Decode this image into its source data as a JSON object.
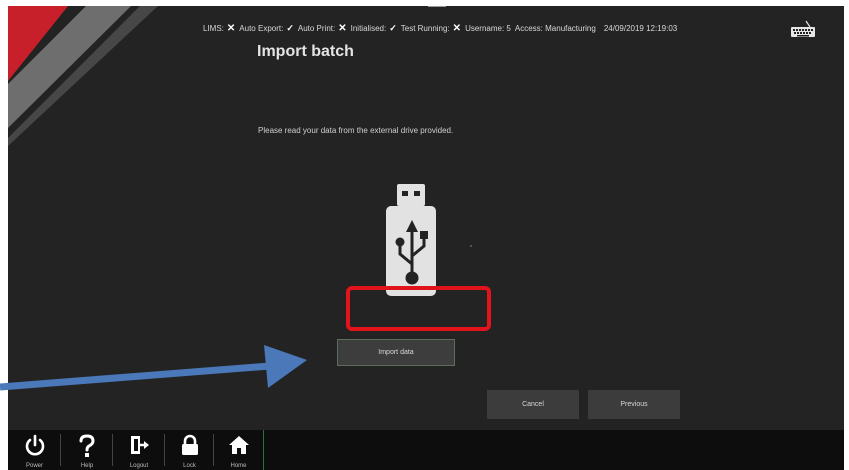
{
  "status": {
    "lims_label": "LIMS:",
    "lims_value": "✕",
    "auto_export_label": "Auto Export:",
    "auto_export_value": "✓",
    "auto_print_label": "Auto Print:",
    "auto_print_value": "✕",
    "initialised_label": "Initialised:",
    "initialised_value": "✓",
    "test_running_label": "Test Running:",
    "test_running_value": "✕",
    "username_label": "Username:",
    "username_value": "5",
    "access_label": "Access:",
    "access_value": "Manufacturing",
    "datetime": "24/09/2019 12:19:03"
  },
  "page": {
    "title": "Import batch",
    "instruction": "Please read your data from the external drive provided."
  },
  "buttons": {
    "import_data": "Import data",
    "cancel": "Cancel",
    "previous": "Previous"
  },
  "nav": {
    "items": [
      {
        "label": "Power",
        "icon": "power-icon"
      },
      {
        "label": "Help",
        "icon": "help-icon"
      },
      {
        "label": "Logout",
        "icon": "logout-icon"
      },
      {
        "label": "Lock",
        "icon": "lock-icon"
      },
      {
        "label": "Home",
        "icon": "home-icon"
      }
    ]
  },
  "colors": {
    "background": "#232323",
    "highlight": "#e3131b",
    "arrow": "#4a78b8",
    "brand_red": "#c8202a"
  }
}
